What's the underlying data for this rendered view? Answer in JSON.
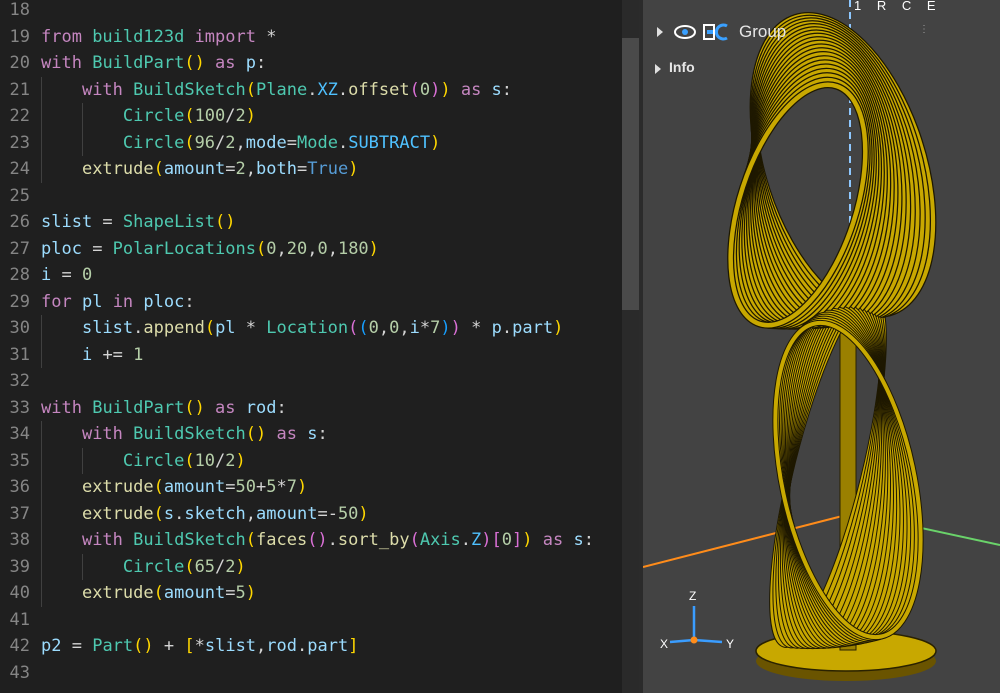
{
  "editor": {
    "lines": [
      {
        "num": "18",
        "tokens": []
      },
      {
        "num": "19",
        "tokens": [
          {
            "t": "from",
            "c": "#c586c0"
          },
          {
            "t": " build123d ",
            "c": "#4ec9b0"
          },
          {
            "t": "import",
            "c": "#c586c0"
          },
          {
            "t": " *",
            "c": "#d4d4d4"
          }
        ]
      },
      {
        "num": "20",
        "tokens": [
          {
            "t": "with",
            "c": "#c586c0"
          },
          {
            "t": " ",
            "c": "#d4d4d4"
          },
          {
            "t": "BuildPart",
            "c": "#4ec9b0"
          },
          {
            "t": "()",
            "c": "#ffd700"
          },
          {
            "t": " as ",
            "c": "#c586c0"
          },
          {
            "t": "p",
            "c": "#9cdcfe"
          },
          {
            "t": ":",
            "c": "#d4d4d4"
          }
        ]
      },
      {
        "num": "21",
        "tokens": [
          {
            "t": "    ",
            "c": "#d4d4d4"
          },
          {
            "t": "with",
            "c": "#c586c0"
          },
          {
            "t": " ",
            "c": "#d4d4d4"
          },
          {
            "t": "BuildSketch",
            "c": "#4ec9b0"
          },
          {
            "t": "(",
            "c": "#ffd700"
          },
          {
            "t": "Plane",
            "c": "#4ec9b0"
          },
          {
            "t": ".",
            "c": "#d4d4d4"
          },
          {
            "t": "XZ",
            "c": "#4fc1ff"
          },
          {
            "t": ".",
            "c": "#d4d4d4"
          },
          {
            "t": "offset",
            "c": "#dcdcaa"
          },
          {
            "t": "(",
            "c": "#da70d6"
          },
          {
            "t": "0",
            "c": "#b5cea8"
          },
          {
            "t": ")",
            "c": "#da70d6"
          },
          {
            "t": ")",
            "c": "#ffd700"
          },
          {
            "t": " as ",
            "c": "#c586c0"
          },
          {
            "t": "s",
            "c": "#9cdcfe"
          },
          {
            "t": ":",
            "c": "#d4d4d4"
          }
        ]
      },
      {
        "num": "22",
        "tokens": [
          {
            "t": "        ",
            "c": "#d4d4d4"
          },
          {
            "t": "Circle",
            "c": "#4ec9b0"
          },
          {
            "t": "(",
            "c": "#ffd700"
          },
          {
            "t": "100",
            "c": "#b5cea8"
          },
          {
            "t": "/",
            "c": "#d4d4d4"
          },
          {
            "t": "2",
            "c": "#b5cea8"
          },
          {
            "t": ")",
            "c": "#ffd700"
          }
        ]
      },
      {
        "num": "23",
        "tokens": [
          {
            "t": "        ",
            "c": "#d4d4d4"
          },
          {
            "t": "Circle",
            "c": "#4ec9b0"
          },
          {
            "t": "(",
            "c": "#ffd700"
          },
          {
            "t": "96",
            "c": "#b5cea8"
          },
          {
            "t": "/",
            "c": "#d4d4d4"
          },
          {
            "t": "2",
            "c": "#b5cea8"
          },
          {
            "t": ",",
            "c": "#d4d4d4"
          },
          {
            "t": "mode",
            "c": "#9cdcfe"
          },
          {
            "t": "=",
            "c": "#d4d4d4"
          },
          {
            "t": "Mode",
            "c": "#4ec9b0"
          },
          {
            "t": ".",
            "c": "#d4d4d4"
          },
          {
            "t": "SUBTRACT",
            "c": "#4fc1ff"
          },
          {
            "t": ")",
            "c": "#ffd700"
          }
        ]
      },
      {
        "num": "24",
        "tokens": [
          {
            "t": "    ",
            "c": "#d4d4d4"
          },
          {
            "t": "extrude",
            "c": "#dcdcaa"
          },
          {
            "t": "(",
            "c": "#ffd700"
          },
          {
            "t": "amount",
            "c": "#9cdcfe"
          },
          {
            "t": "=",
            "c": "#d4d4d4"
          },
          {
            "t": "2",
            "c": "#b5cea8"
          },
          {
            "t": ",",
            "c": "#d4d4d4"
          },
          {
            "t": "both",
            "c": "#9cdcfe"
          },
          {
            "t": "=",
            "c": "#d4d4d4"
          },
          {
            "t": "True",
            "c": "#569cd6"
          },
          {
            "t": ")",
            "c": "#ffd700"
          }
        ]
      },
      {
        "num": "25",
        "tokens": []
      },
      {
        "num": "26",
        "tokens": [
          {
            "t": "slist",
            "c": "#9cdcfe"
          },
          {
            "t": " = ",
            "c": "#d4d4d4"
          },
          {
            "t": "ShapeList",
            "c": "#4ec9b0"
          },
          {
            "t": "()",
            "c": "#ffd700"
          }
        ]
      },
      {
        "num": "27",
        "tokens": [
          {
            "t": "ploc",
            "c": "#9cdcfe"
          },
          {
            "t": " = ",
            "c": "#d4d4d4"
          },
          {
            "t": "PolarLocations",
            "c": "#4ec9b0"
          },
          {
            "t": "(",
            "c": "#ffd700"
          },
          {
            "t": "0",
            "c": "#b5cea8"
          },
          {
            "t": ",",
            "c": "#d4d4d4"
          },
          {
            "t": "20",
            "c": "#b5cea8"
          },
          {
            "t": ",",
            "c": "#d4d4d4"
          },
          {
            "t": "0",
            "c": "#b5cea8"
          },
          {
            "t": ",",
            "c": "#d4d4d4"
          },
          {
            "t": "180",
            "c": "#b5cea8"
          },
          {
            "t": ")",
            "c": "#ffd700"
          }
        ]
      },
      {
        "num": "28",
        "tokens": [
          {
            "t": "i",
            "c": "#9cdcfe"
          },
          {
            "t": " = ",
            "c": "#d4d4d4"
          },
          {
            "t": "0",
            "c": "#b5cea8"
          }
        ]
      },
      {
        "num": "29",
        "tokens": [
          {
            "t": "for",
            "c": "#c586c0"
          },
          {
            "t": " ",
            "c": "#d4d4d4"
          },
          {
            "t": "pl",
            "c": "#9cdcfe"
          },
          {
            "t": " in ",
            "c": "#c586c0"
          },
          {
            "t": "ploc",
            "c": "#9cdcfe"
          },
          {
            "t": ":",
            "c": "#d4d4d4"
          }
        ]
      },
      {
        "num": "30",
        "tokens": [
          {
            "t": "    ",
            "c": "#d4d4d4"
          },
          {
            "t": "slist",
            "c": "#9cdcfe"
          },
          {
            "t": ".",
            "c": "#d4d4d4"
          },
          {
            "t": "append",
            "c": "#dcdcaa"
          },
          {
            "t": "(",
            "c": "#ffd700"
          },
          {
            "t": "pl",
            "c": "#9cdcfe"
          },
          {
            "t": " * ",
            "c": "#d4d4d4"
          },
          {
            "t": "Location",
            "c": "#4ec9b0"
          },
          {
            "t": "(",
            "c": "#da70d6"
          },
          {
            "t": "(",
            "c": "#179fff"
          },
          {
            "t": "0",
            "c": "#b5cea8"
          },
          {
            "t": ",",
            "c": "#d4d4d4"
          },
          {
            "t": "0",
            "c": "#b5cea8"
          },
          {
            "t": ",",
            "c": "#d4d4d4"
          },
          {
            "t": "i",
            "c": "#9cdcfe"
          },
          {
            "t": "*",
            "c": "#d4d4d4"
          },
          {
            "t": "7",
            "c": "#b5cea8"
          },
          {
            "t": ")",
            "c": "#179fff"
          },
          {
            "t": ")",
            "c": "#da70d6"
          },
          {
            "t": " * ",
            "c": "#d4d4d4"
          },
          {
            "t": "p",
            "c": "#9cdcfe"
          },
          {
            "t": ".",
            "c": "#d4d4d4"
          },
          {
            "t": "part",
            "c": "#9cdcfe"
          },
          {
            "t": ")",
            "c": "#ffd700"
          }
        ]
      },
      {
        "num": "31",
        "tokens": [
          {
            "t": "    ",
            "c": "#d4d4d4"
          },
          {
            "t": "i",
            "c": "#9cdcfe"
          },
          {
            "t": " += ",
            "c": "#d4d4d4"
          },
          {
            "t": "1",
            "c": "#b5cea8"
          }
        ]
      },
      {
        "num": "32",
        "tokens": []
      },
      {
        "num": "33",
        "tokens": [
          {
            "t": "with",
            "c": "#c586c0"
          },
          {
            "t": " ",
            "c": "#d4d4d4"
          },
          {
            "t": "BuildPart",
            "c": "#4ec9b0"
          },
          {
            "t": "()",
            "c": "#ffd700"
          },
          {
            "t": " as ",
            "c": "#c586c0"
          },
          {
            "t": "rod",
            "c": "#9cdcfe"
          },
          {
            "t": ":",
            "c": "#d4d4d4"
          }
        ]
      },
      {
        "num": "34",
        "tokens": [
          {
            "t": "    ",
            "c": "#d4d4d4"
          },
          {
            "t": "with",
            "c": "#c586c0"
          },
          {
            "t": " ",
            "c": "#d4d4d4"
          },
          {
            "t": "BuildSketch",
            "c": "#4ec9b0"
          },
          {
            "t": "()",
            "c": "#ffd700"
          },
          {
            "t": " as ",
            "c": "#c586c0"
          },
          {
            "t": "s",
            "c": "#9cdcfe"
          },
          {
            "t": ":",
            "c": "#d4d4d4"
          }
        ]
      },
      {
        "num": "35",
        "tokens": [
          {
            "t": "        ",
            "c": "#d4d4d4"
          },
          {
            "t": "Circle",
            "c": "#4ec9b0"
          },
          {
            "t": "(",
            "c": "#ffd700"
          },
          {
            "t": "10",
            "c": "#b5cea8"
          },
          {
            "t": "/",
            "c": "#d4d4d4"
          },
          {
            "t": "2",
            "c": "#b5cea8"
          },
          {
            "t": ")",
            "c": "#ffd700"
          }
        ]
      },
      {
        "num": "36",
        "tokens": [
          {
            "t": "    ",
            "c": "#d4d4d4"
          },
          {
            "t": "extrude",
            "c": "#dcdcaa"
          },
          {
            "t": "(",
            "c": "#ffd700"
          },
          {
            "t": "amount",
            "c": "#9cdcfe"
          },
          {
            "t": "=",
            "c": "#d4d4d4"
          },
          {
            "t": "50",
            "c": "#b5cea8"
          },
          {
            "t": "+",
            "c": "#d4d4d4"
          },
          {
            "t": "5",
            "c": "#b5cea8"
          },
          {
            "t": "*",
            "c": "#d4d4d4"
          },
          {
            "t": "7",
            "c": "#b5cea8"
          },
          {
            "t": ")",
            "c": "#ffd700"
          }
        ]
      },
      {
        "num": "37",
        "tokens": [
          {
            "t": "    ",
            "c": "#d4d4d4"
          },
          {
            "t": "extrude",
            "c": "#dcdcaa"
          },
          {
            "t": "(",
            "c": "#ffd700"
          },
          {
            "t": "s",
            "c": "#9cdcfe"
          },
          {
            "t": ".",
            "c": "#d4d4d4"
          },
          {
            "t": "sketch",
            "c": "#9cdcfe"
          },
          {
            "t": ",",
            "c": "#d4d4d4"
          },
          {
            "t": "amount",
            "c": "#9cdcfe"
          },
          {
            "t": "=-",
            "c": "#d4d4d4"
          },
          {
            "t": "50",
            "c": "#b5cea8"
          },
          {
            "t": ")",
            "c": "#ffd700"
          }
        ]
      },
      {
        "num": "38",
        "tokens": [
          {
            "t": "    ",
            "c": "#d4d4d4"
          },
          {
            "t": "with",
            "c": "#c586c0"
          },
          {
            "t": " ",
            "c": "#d4d4d4"
          },
          {
            "t": "BuildSketch",
            "c": "#4ec9b0"
          },
          {
            "t": "(",
            "c": "#ffd700"
          },
          {
            "t": "faces",
            "c": "#dcdcaa"
          },
          {
            "t": "()",
            "c": "#da70d6"
          },
          {
            "t": ".",
            "c": "#d4d4d4"
          },
          {
            "t": "sort_by",
            "c": "#dcdcaa"
          },
          {
            "t": "(",
            "c": "#da70d6"
          },
          {
            "t": "Axis",
            "c": "#4ec9b0"
          },
          {
            "t": ".",
            "c": "#d4d4d4"
          },
          {
            "t": "Z",
            "c": "#4fc1ff"
          },
          {
            "t": ")",
            "c": "#da70d6"
          },
          {
            "t": "[",
            "c": "#da70d6"
          },
          {
            "t": "0",
            "c": "#b5cea8"
          },
          {
            "t": "]",
            "c": "#da70d6"
          },
          {
            "t": ")",
            "c": "#ffd700"
          },
          {
            "t": " as ",
            "c": "#c586c0"
          },
          {
            "t": "s",
            "c": "#9cdcfe"
          },
          {
            "t": ":",
            "c": "#d4d4d4"
          }
        ]
      },
      {
        "num": "39",
        "tokens": [
          {
            "t": "        ",
            "c": "#d4d4d4"
          },
          {
            "t": "Circle",
            "c": "#4ec9b0"
          },
          {
            "t": "(",
            "c": "#ffd700"
          },
          {
            "t": "65",
            "c": "#b5cea8"
          },
          {
            "t": "/",
            "c": "#d4d4d4"
          },
          {
            "t": "2",
            "c": "#b5cea8"
          },
          {
            "t": ")",
            "c": "#ffd700"
          }
        ]
      },
      {
        "num": "40",
        "tokens": [
          {
            "t": "    ",
            "c": "#d4d4d4"
          },
          {
            "t": "extrude",
            "c": "#dcdcaa"
          },
          {
            "t": "(",
            "c": "#ffd700"
          },
          {
            "t": "amount",
            "c": "#9cdcfe"
          },
          {
            "t": "=",
            "c": "#d4d4d4"
          },
          {
            "t": "5",
            "c": "#b5cea8"
          },
          {
            "t": ")",
            "c": "#ffd700"
          }
        ]
      },
      {
        "num": "41",
        "tokens": []
      },
      {
        "num": "42",
        "tokens": [
          {
            "t": "p2",
            "c": "#9cdcfe"
          },
          {
            "t": " = ",
            "c": "#d4d4d4"
          },
          {
            "t": "Part",
            "c": "#4ec9b0"
          },
          {
            "t": "()",
            "c": "#ffd700"
          },
          {
            "t": " + ",
            "c": "#d4d4d4"
          },
          {
            "t": "[",
            "c": "#ffd700"
          },
          {
            "t": "*",
            "c": "#d4d4d4"
          },
          {
            "t": "slist",
            "c": "#9cdcfe"
          },
          {
            "t": ",",
            "c": "#d4d4d4"
          },
          {
            "t": "rod",
            "c": "#9cdcfe"
          },
          {
            "t": ".",
            "c": "#d4d4d4"
          },
          {
            "t": "part",
            "c": "#9cdcfe"
          },
          {
            "t": "]",
            "c": "#ffd700"
          }
        ]
      },
      {
        "num": "43",
        "tokens": []
      }
    ]
  },
  "viewer": {
    "tree": {
      "group_label": "Group",
      "info_label": "Info",
      "eye_icon": "eye-icon",
      "shape_icon": "shape-mode-icon"
    },
    "view_labels": [
      "1",
      "R",
      "C",
      "E"
    ],
    "triad": {
      "x_label": "X",
      "y_label": "Y",
      "z_label": "Z"
    },
    "model_color": "#c8a800",
    "axis_colors": {
      "x": "#ff8c1a",
      "y": "#6ad36a",
      "z": "#8ec8ff"
    }
  }
}
